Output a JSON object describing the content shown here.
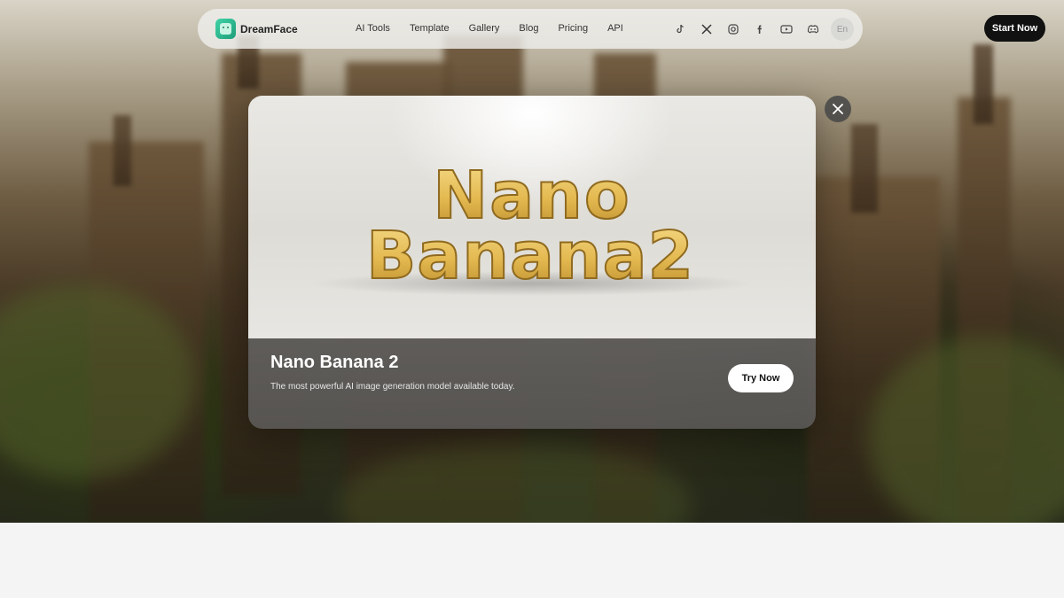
{
  "nav": {
    "brand": "DreamFace",
    "links": [
      "AI Tools",
      "Template",
      "Gallery",
      "Blog",
      "Pricing",
      "API"
    ],
    "social_icons": [
      "tiktok-icon",
      "x-icon",
      "instagram-icon",
      "facebook-icon",
      "youtube-icon",
      "discord-icon"
    ],
    "language": "En"
  },
  "header": {
    "start_label": "Start Now"
  },
  "modal": {
    "promo_text_line1": "Nano",
    "promo_text_line2": "Banana2",
    "title": "Nano Banana 2",
    "description": "The most powerful AI image generation model available today.",
    "cta_label": "Try Now"
  },
  "colors": {
    "brand_green": "#2fbf92",
    "start_button": "#111111",
    "banana_yellow": "#e8c25a"
  }
}
